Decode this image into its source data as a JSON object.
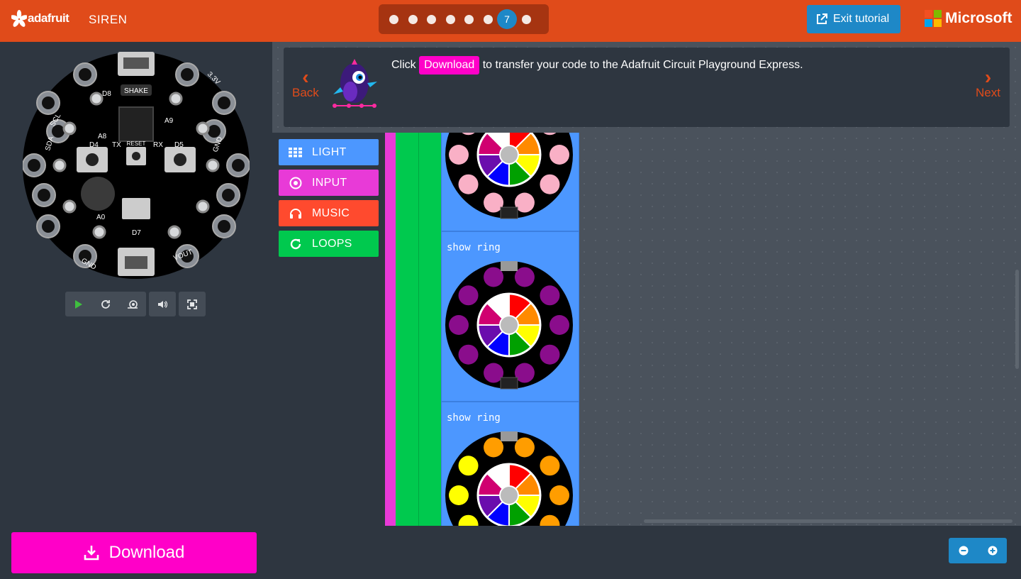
{
  "header": {
    "brand": "adafruit",
    "project_name": "SIREN",
    "steps": [
      "",
      "",
      "",
      "",
      "",
      "",
      "7",
      ""
    ],
    "current_step": "7",
    "exit_label": "Exit tutorial",
    "ms_label": "Microsoft"
  },
  "board": {
    "shake_label": "SHAKE",
    "reset_label": "RESET",
    "pins": [
      "GND",
      "D8",
      "D13",
      "3.3V",
      "A3",
      "A2",
      "GND",
      "A1",
      "A0",
      "VOUT",
      "GND",
      "A7",
      "A6",
      "RX",
      "3.3V",
      "SDA",
      "SCL",
      "A4",
      "A5",
      "A8",
      "A9",
      "D4",
      "D5",
      "TX",
      "RX",
      "D7",
      "A0"
    ]
  },
  "tutorial": {
    "back_label": "Back",
    "next_label": "Next",
    "text_before": "Click",
    "highlight": "Download",
    "text_after": "to transfer your code to the Adafruit Circuit Playground Express."
  },
  "toolbox": {
    "categories": [
      {
        "label": "LIGHT",
        "color": "#4c97ff"
      },
      {
        "label": "INPUT",
        "color": "#e83ad7"
      },
      {
        "label": "MUSIC",
        "color": "#ff4a2e"
      },
      {
        "label": "LOOPS",
        "color": "#00c94e"
      }
    ]
  },
  "blocks": {
    "label_1": "show ring",
    "label_2": "show ring",
    "ring_colors": {
      "ring_0": "#f9b0c6",
      "ring_1": "#8a0d8c",
      "ring_2": [
        "#ff9d00",
        "#ff9d00",
        "#ff9d00",
        "#ff9d00",
        "#ff9d00",
        "#ffff00",
        "#ffff00",
        "#ffff00",
        "#ffff00",
        "#ff9d00"
      ]
    }
  },
  "bottom": {
    "download_label": "Download"
  },
  "colors": {
    "header_bg": "#e04b1a",
    "accent_blue": "#1e88c7",
    "download_pink": "#ff00c8"
  }
}
